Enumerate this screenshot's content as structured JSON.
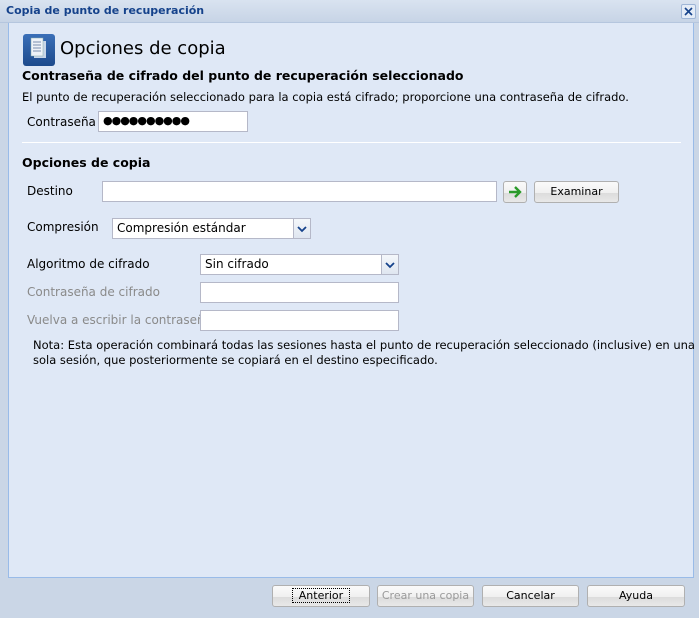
{
  "window": {
    "title": "Copia de punto de recuperación"
  },
  "header": {
    "title": "Opciones de copia"
  },
  "encryption_section": {
    "heading": "Contraseña de cifrado del punto de recuperación seleccionado",
    "description": "El punto de recuperación seleccionado para la copia está cifrado; proporcione una contraseña de cifrado.",
    "password_label": "Contraseña",
    "password_value": "●●●●●●●●●●"
  },
  "copy_options": {
    "heading": "Opciones de copia",
    "destination_label": "Destino",
    "destination_value": "",
    "browse_label": "Examinar",
    "compression_label": "Compresión",
    "compression_value": "Compresión estándar",
    "algorithm_label": "Algoritmo de cifrado",
    "algorithm_value": "Sin cifrado",
    "cipher_password_label": "Contraseña de cifrado",
    "retype_password_label": "Vuelva a escribir la contraseña",
    "note_line1": "Nota: Esta operación combinará todas las sesiones hasta el punto de recuperación seleccionado (inclusive) en una",
    "note_line2": "sola sesión, que posteriormente se copiará en el destino especificado."
  },
  "footer": {
    "back": "Anterior",
    "create": "Crear una copia",
    "cancel": "Cancelar",
    "help": "Ayuda"
  }
}
